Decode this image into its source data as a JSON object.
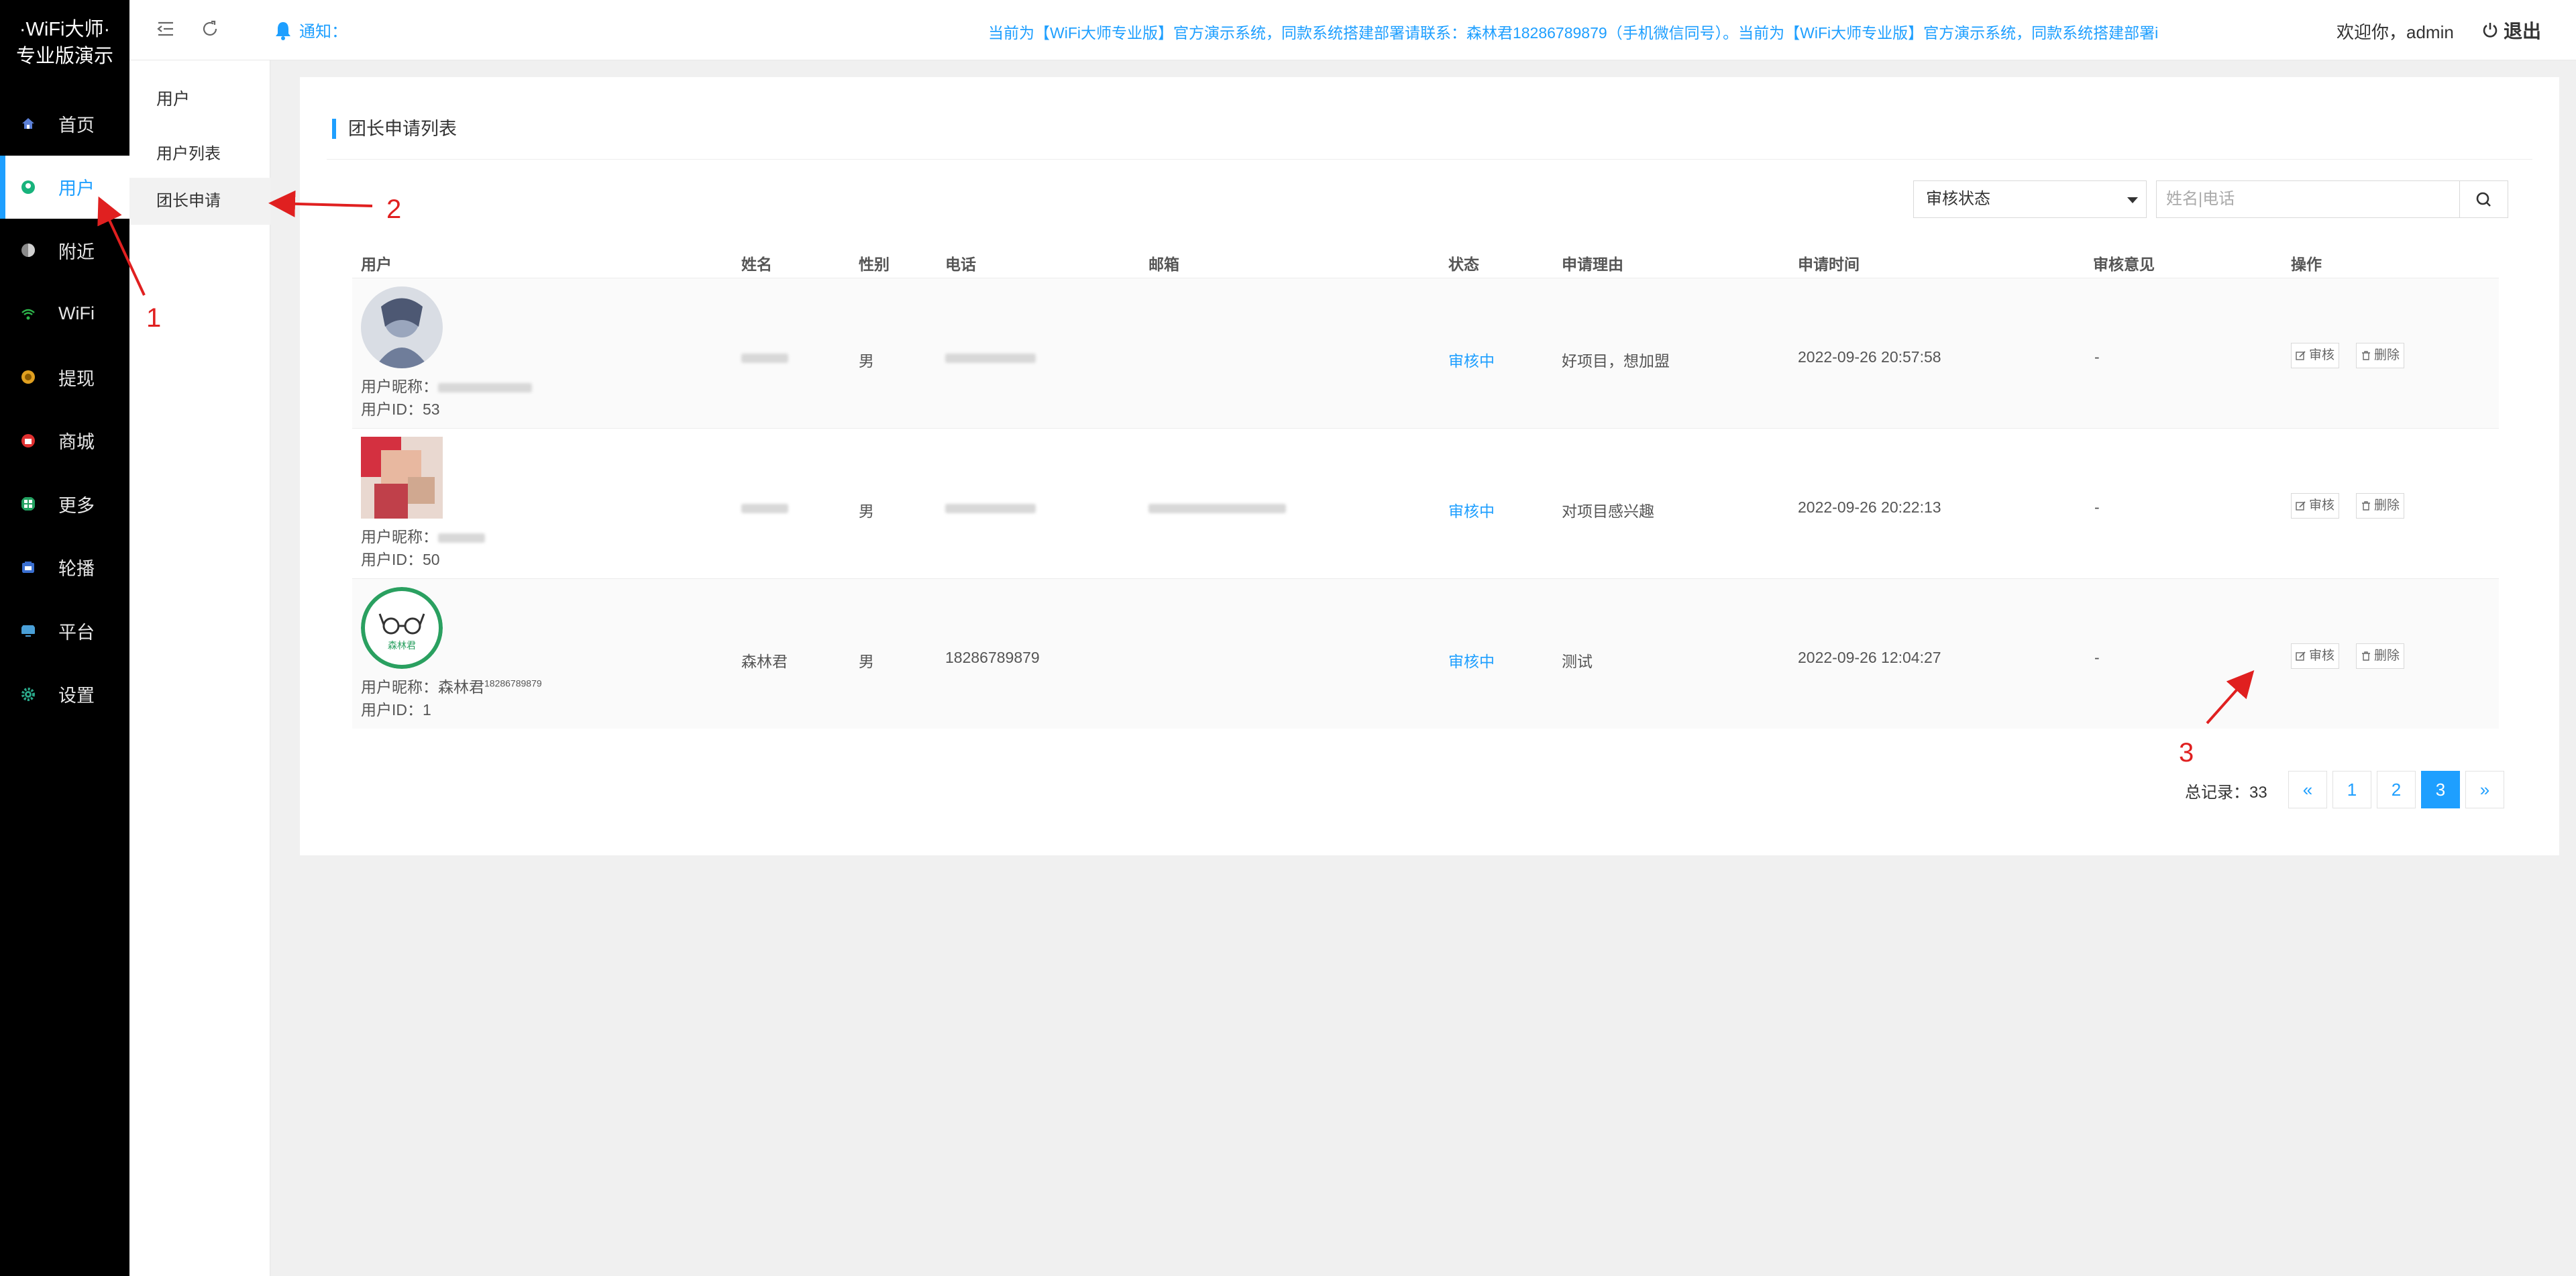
{
  "brand": {
    "line1": "·WiFi大师·",
    "line2": "专业版演示"
  },
  "nav": [
    {
      "label": "首页",
      "color": "#5b7fd6"
    },
    {
      "label": "用户",
      "color": "#18b37c"
    },
    {
      "label": "附近",
      "color": "#8a8a8a"
    },
    {
      "label": "WiFi",
      "color": "#2db34a"
    },
    {
      "label": "提现",
      "color": "#e0a020"
    },
    {
      "label": "商城",
      "color": "#e03030"
    },
    {
      "label": "更多",
      "color": "#22a060"
    },
    {
      "label": "轮播",
      "color": "#3a6fd0"
    },
    {
      "label": "平台",
      "color": "#4aa0d8"
    },
    {
      "label": "设置",
      "color": "#2aa88a"
    }
  ],
  "subnav": {
    "title": "用户",
    "items": [
      "用户列表",
      "团长申请"
    ]
  },
  "header": {
    "notice_label": "通知：",
    "notice_text": "当前为【WiFi大师专业版】官方演示系统，同款系统搭建部署请联系：森林君18286789879（手机微信同号）。当前为【WiFi大师专业版】官方演示系统，同款系统搭建部署i",
    "welcome": "欢迎你，admin",
    "logout": "退出"
  },
  "page": {
    "title": "团长申请列表",
    "filter_select": "审核状态",
    "search_placeholder": "姓名|电话"
  },
  "table": {
    "columns": [
      "用户",
      "姓名",
      "性别",
      "电话",
      "邮箱",
      "状态",
      "申请理由",
      "申请时间",
      "审核意见",
      "操作"
    ],
    "rows": [
      {
        "nick_label": "用户昵称：",
        "nick": "",
        "uid": "用户ID：53",
        "name": "",
        "gender": "男",
        "phone": "",
        "email": "",
        "status": "审核中",
        "reason": "好项目，想加盟",
        "time": "2022-09-26 20:57:58",
        "opinion": "-",
        "review": "审核",
        "delete": "删除"
      },
      {
        "nick_label": "用户昵称：",
        "nick": "",
        "uid": "用户ID：50",
        "name": "",
        "gender": "男",
        "phone": "",
        "email": "",
        "status": "审核中",
        "reason": "对项目感兴趣",
        "time": "2022-09-26 20:22:13",
        "opinion": "-",
        "review": "审核",
        "delete": "删除"
      },
      {
        "nick_label": "用户昵称：",
        "nick": "森林君",
        "nick_sup": "18286789879",
        "uid": "用户ID：1",
        "name": "森林君",
        "gender": "男",
        "phone": "18286789879",
        "email": "",
        "status": "审核中",
        "reason": "测试",
        "time": "2022-09-26 12:04:27",
        "opinion": "-",
        "review": "审核",
        "delete": "删除",
        "avatar_text": "森林君"
      }
    ]
  },
  "pagination": {
    "total": "总记录：33",
    "prev": "«",
    "pages": [
      "1",
      "2",
      "3"
    ],
    "next": "»",
    "current": "3"
  },
  "annotations": [
    "1",
    "2",
    "3"
  ]
}
